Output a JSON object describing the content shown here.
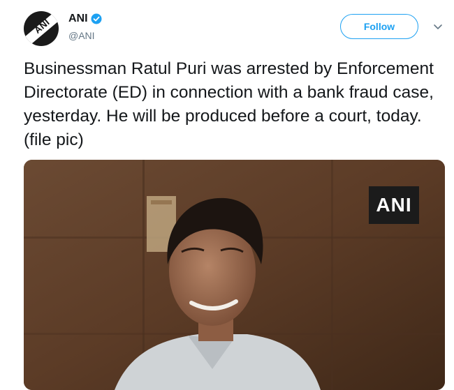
{
  "account": {
    "display_name": "ANI",
    "handle": "@ANI",
    "avatar_logo_text": "ANI",
    "verified": true
  },
  "actions": {
    "follow_label": "Follow",
    "more_icon": "chevron-down-icon"
  },
  "tweet": {
    "text": "Businessman Ratul Puri was arrested by Enforcement Directorate (ED) in connection with a bank fraud case, yesterday. He will be produced before a court, today. (file pic)"
  },
  "media": {
    "watermark": "ANI"
  },
  "colors": {
    "accent": "#1da1f2",
    "text": "#14171a",
    "secondary_text": "#657786"
  }
}
